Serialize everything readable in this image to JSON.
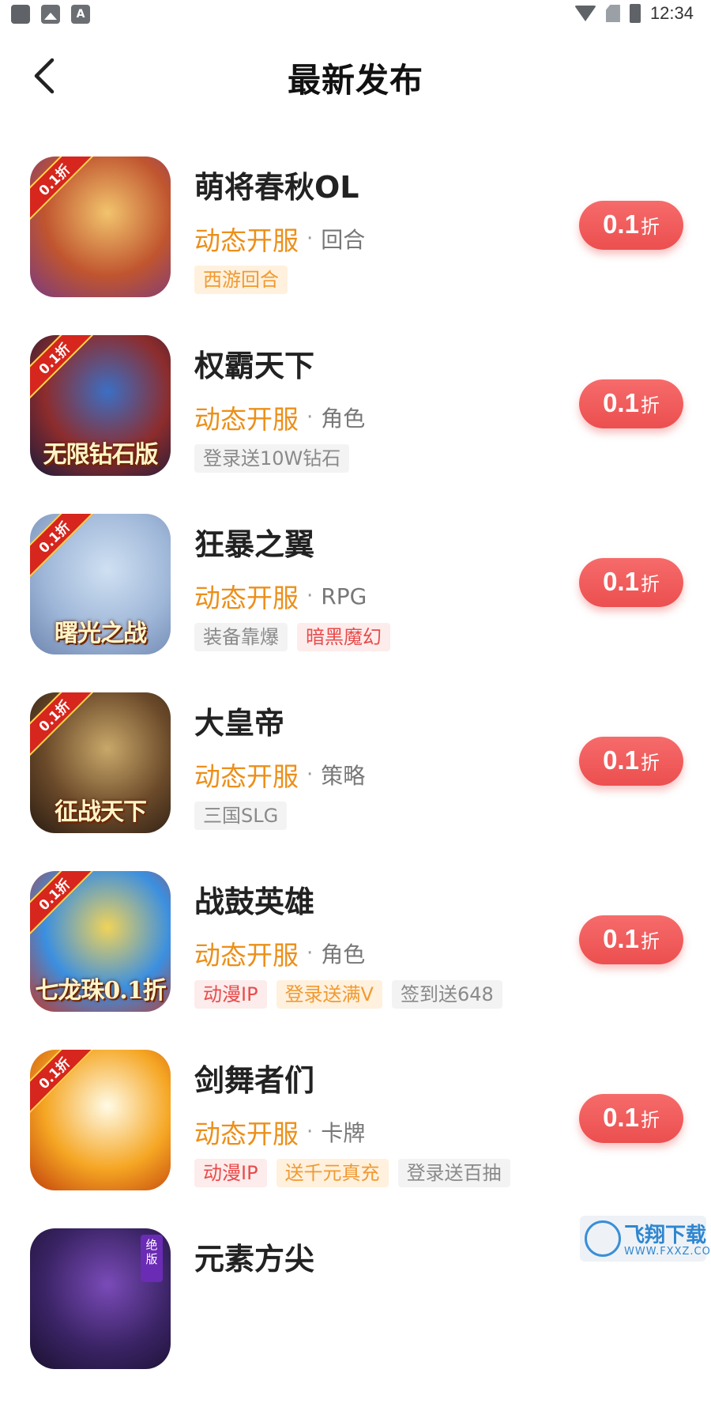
{
  "status_bar": {
    "time": "12:34"
  },
  "header": {
    "title": "最新发布",
    "back_icon": "chevron-left-icon"
  },
  "games": [
    {
      "name": "萌将春秋OL",
      "server_label": "动态开服",
      "genre": "回合",
      "tags": [
        {
          "text": "西游回合",
          "style": "orange"
        }
      ],
      "discount": {
        "value": "0.1",
        "unit": "折"
      },
      "icon": {
        "ribbon": "0.1折",
        "banner": "",
        "colors": [
          "#f2c46d",
          "#c0552f",
          "#7a3b7f"
        ]
      }
    },
    {
      "name": "权霸天下",
      "server_label": "动态开服",
      "genre": "角色",
      "tags": [
        {
          "text": "登录送10W钻石",
          "style": "grey"
        }
      ],
      "discount": {
        "value": "0.1",
        "unit": "折"
      },
      "icon": {
        "ribbon": "0.1折",
        "banner": "无限钻石版",
        "colors": [
          "#3b6fc4",
          "#8d2c2c",
          "#1b1b3a"
        ]
      }
    },
    {
      "name": "狂暴之翼",
      "server_label": "动态开服",
      "genre": "RPG",
      "tags": [
        {
          "text": "装备靠爆",
          "style": "grey"
        },
        {
          "text": "暗黑魔幻",
          "style": "red"
        }
      ],
      "discount": {
        "value": "0.1",
        "unit": "折"
      },
      "icon": {
        "ribbon": "0.1折",
        "banner": "曙光之战",
        "colors": [
          "#cfe0f2",
          "#9fb7d8",
          "#6f86b0"
        ]
      }
    },
    {
      "name": "大皇帝",
      "server_label": "动态开服",
      "genre": "策略",
      "tags": [
        {
          "text": "三国SLG",
          "style": "grey"
        }
      ],
      "discount": {
        "value": "0.1",
        "unit": "折"
      },
      "icon": {
        "ribbon": "0.1折",
        "banner": "征战天下",
        "colors": [
          "#c9a86a",
          "#6b4a2a",
          "#2a1c12"
        ]
      }
    },
    {
      "name": "战鼓英雄",
      "server_label": "动态开服",
      "genre": "角色",
      "tags": [
        {
          "text": "动漫IP",
          "style": "red"
        },
        {
          "text": "登录送满V",
          "style": "orange"
        },
        {
          "text": "签到送648",
          "style": "grey"
        }
      ],
      "discount": {
        "value": "0.1",
        "unit": "折"
      },
      "icon": {
        "ribbon": "0.1折",
        "banner": "七龙珠0.1折",
        "colors": [
          "#f0d35a",
          "#3b8fe0",
          "#c0392b"
        ]
      }
    },
    {
      "name": "剑舞者们",
      "server_label": "动态开服",
      "genre": "卡牌",
      "tags": [
        {
          "text": "动漫IP",
          "style": "red"
        },
        {
          "text": "送千元真充",
          "style": "orange"
        },
        {
          "text": "登录送百抽",
          "style": "grey"
        }
      ],
      "discount": {
        "value": "0.1",
        "unit": "折"
      },
      "icon": {
        "ribbon": "0.1折",
        "banner": "",
        "colors": [
          "#fffbe6",
          "#f5a623",
          "#c2410c"
        ]
      }
    },
    {
      "name": "元素方尖",
      "server_label": "",
      "genre": "",
      "tags": [],
      "discount": null,
      "icon": {
        "ribbon": "",
        "banner": "",
        "side_tag": "绝版",
        "colors": [
          "#7a4bb8",
          "#3b2466",
          "#1a1030"
        ]
      }
    }
  ],
  "watermark": {
    "text": "飞翔下载",
    "url": "WWW.FXXZ.COM"
  }
}
